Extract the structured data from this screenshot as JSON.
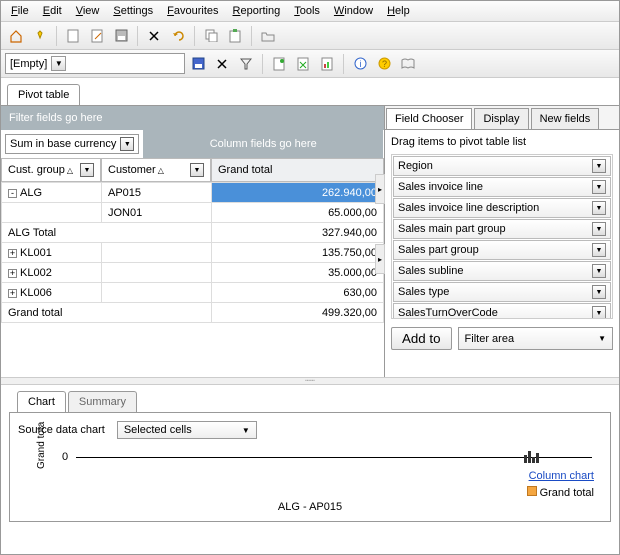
{
  "menu": [
    "File",
    "Edit",
    "View",
    "Settings",
    "Favourites",
    "Reporting",
    "Tools",
    "Window",
    "Help"
  ],
  "toolbar1": {
    "empty_combo": "[Empty]"
  },
  "tabs": {
    "pivot": "Pivot table"
  },
  "pivot": {
    "filter_hint": "Filter fields go here",
    "sum_label": "Sum in base currency",
    "col_hint": "Column fields go here",
    "col_group": "Cust. group",
    "col_customer": "Customer",
    "col_grand": "Grand total",
    "rows": [
      {
        "g": "ALG",
        "c": "AP015",
        "v": "262.940,00",
        "exp": "-",
        "sel": true
      },
      {
        "g": "",
        "c": "JON01",
        "v": "65.000,00"
      },
      {
        "g": "ALG Total",
        "c": "",
        "v": "327.940,00",
        "total": true
      },
      {
        "g": "KL001",
        "c": "",
        "v": "135.750,00",
        "exp": "+"
      },
      {
        "g": "KL002",
        "c": "",
        "v": "35.000,00",
        "exp": "+"
      },
      {
        "g": "KL006",
        "c": "",
        "v": "630,00",
        "exp": "+"
      },
      {
        "g": "Grand total",
        "c": "",
        "v": "499.320,00",
        "total": true
      }
    ]
  },
  "chooser": {
    "tabs": [
      "Field Chooser",
      "Display",
      "New fields"
    ],
    "hint": "Drag items to pivot table list",
    "fields": [
      "Region",
      "Sales invoice line",
      "Sales invoice line description",
      "Sales main part group",
      "Sales part group",
      "Sales subline",
      "Sales type",
      "SalesTurnOverCode"
    ],
    "addto": "Add to",
    "filterarea": "Filter area"
  },
  "bottom": {
    "tabs": [
      "Chart",
      "Summary"
    ],
    "source_label": "Source data chart",
    "source_combo": "Selected cells",
    "zero": "0",
    "ylab": "Grand tota",
    "xlab": "ALG - AP015",
    "link": "Column chart",
    "legend": "Grand total"
  }
}
